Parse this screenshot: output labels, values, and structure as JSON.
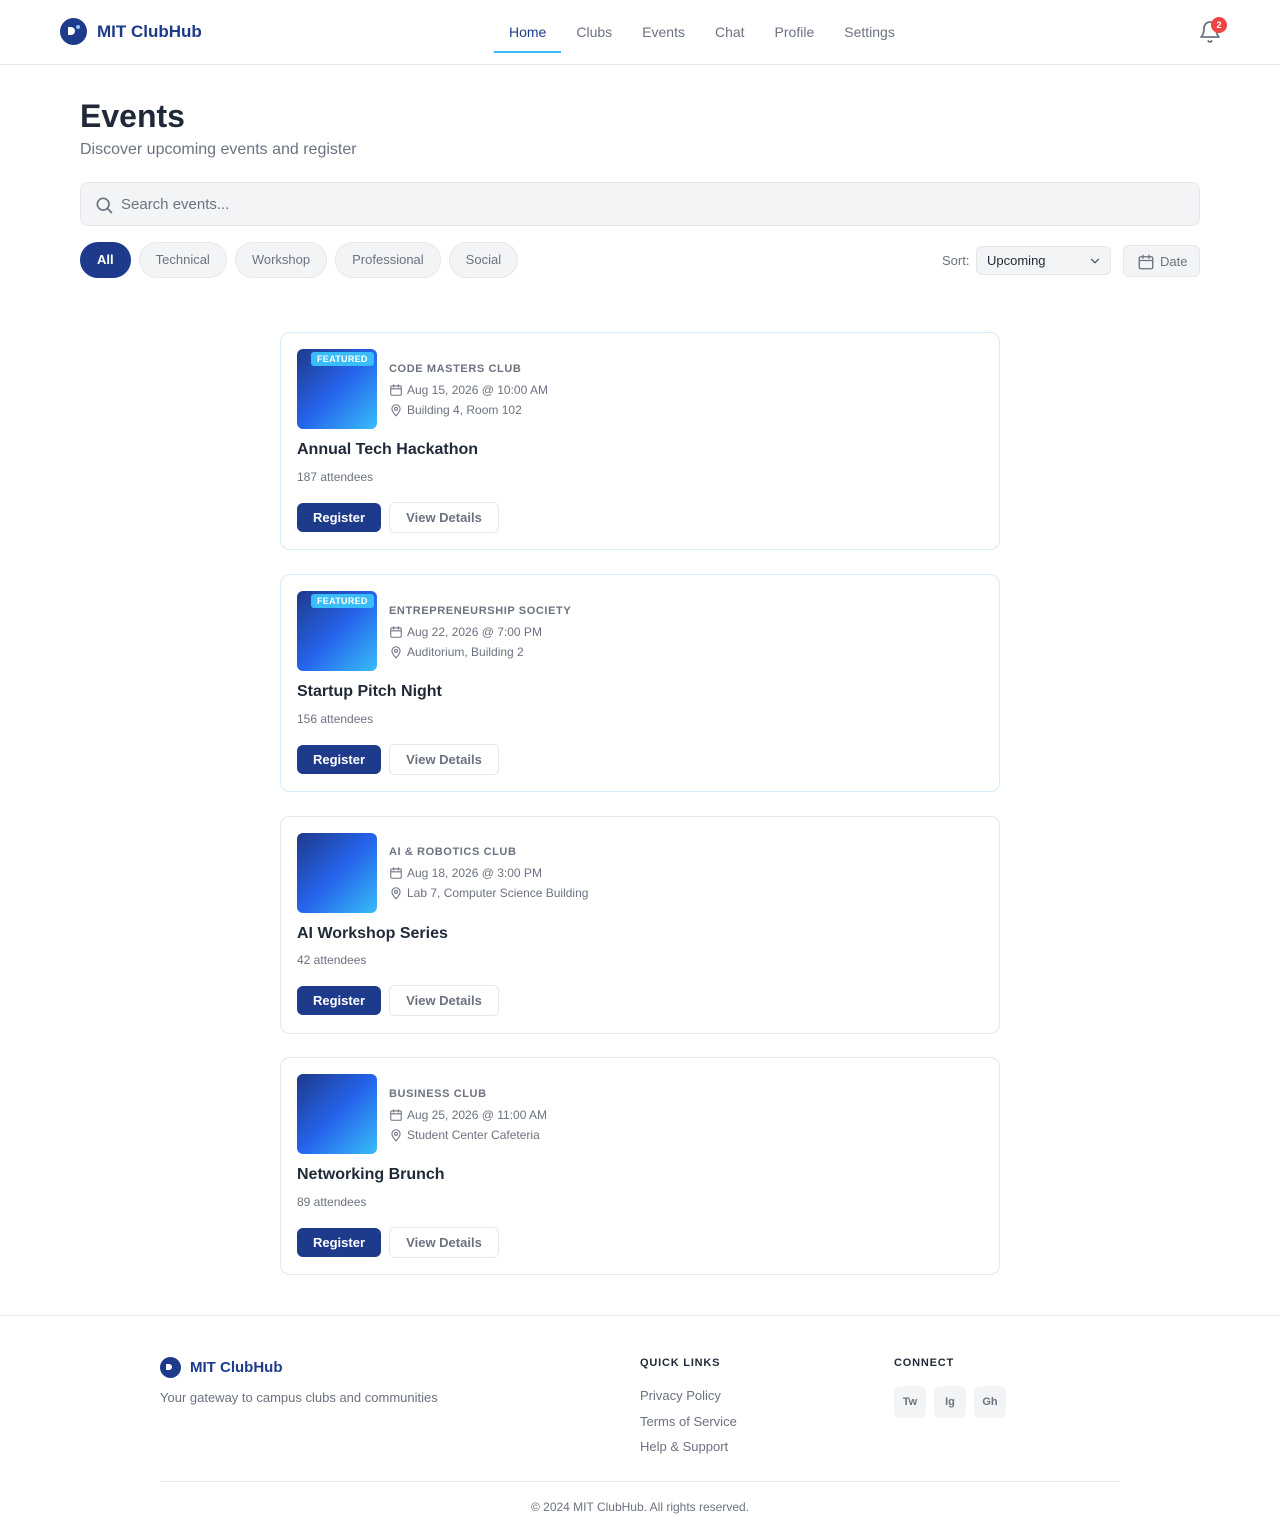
{
  "app": {
    "name": "MIT ClubHub"
  },
  "nav": {
    "items": [
      {
        "label": "Home",
        "active": true
      },
      {
        "label": "Clubs"
      },
      {
        "label": "Events"
      },
      {
        "label": "Chat"
      },
      {
        "label": "Profile"
      },
      {
        "label": "Settings"
      }
    ],
    "notifications_count": "2"
  },
  "page": {
    "title": "Events",
    "subtitle": "Discover upcoming events and register"
  },
  "search": {
    "placeholder": "Search events...",
    "value": ""
  },
  "filters": {
    "chips": [
      "All",
      "Technical",
      "Workshop",
      "Professional",
      "Social"
    ],
    "active": "All",
    "sort_label": "Sort:",
    "sort_value": "Upcoming",
    "date_label": "Date"
  },
  "events": [
    {
      "featured": true,
      "badge": "FEATURED",
      "club": "CODE MASTERS CLUB",
      "datetime": "Aug 15, 2026 @ 10:00 AM",
      "location": "Building 4, Room 102",
      "title": "Annual Tech Hackathon",
      "attendees": "187 attendees",
      "register_label": "Register",
      "details_label": "View Details"
    },
    {
      "featured": true,
      "badge": "FEATURED",
      "club": "ENTREPRENEURSHIP SOCIETY",
      "datetime": "Aug 22, 2026 @ 7:00 PM",
      "location": "Auditorium, Building 2",
      "title": "Startup Pitch Night",
      "attendees": "156 attendees",
      "register_label": "Register",
      "details_label": "View Details"
    },
    {
      "featured": false,
      "club": "AI & ROBOTICS CLUB",
      "datetime": "Aug 18, 2026 @ 3:00 PM",
      "location": "Lab 7, Computer Science Building",
      "title": "AI Workshop Series",
      "attendees": "42 attendees",
      "register_label": "Register",
      "details_label": "View Details"
    },
    {
      "featured": false,
      "club": "BUSINESS CLUB",
      "datetime": "Aug 25, 2026 @ 11:00 AM",
      "location": "Student Center Cafeteria",
      "title": "Networking Brunch",
      "attendees": "89 attendees",
      "register_label": "Register",
      "details_label": "View Details"
    }
  ],
  "footer": {
    "brand": "MIT ClubHub",
    "tagline": "Your gateway to campus clubs and communities",
    "quick_links_heading": "QUICK LINKS",
    "quick_links": [
      "Privacy Policy",
      "Terms of Service",
      "Help & Support"
    ],
    "connect_heading": "CONNECT",
    "socials": [
      "Tw",
      "Ig",
      "Gh"
    ],
    "copyright": "© 2024 MIT ClubHub. All rights reserved."
  },
  "colors": {
    "primary": "#1e3a8a",
    "accent": "#38bdf8",
    "badge": "#ef4444"
  },
  "icons": {
    "logo": "logo-icon",
    "notification": "bell-icon",
    "search": "search-icon",
    "sort": "chevron-down-icon",
    "date": "calendar-icon",
    "event_date": "calendar-icon",
    "event_location": "map-pin-icon"
  }
}
